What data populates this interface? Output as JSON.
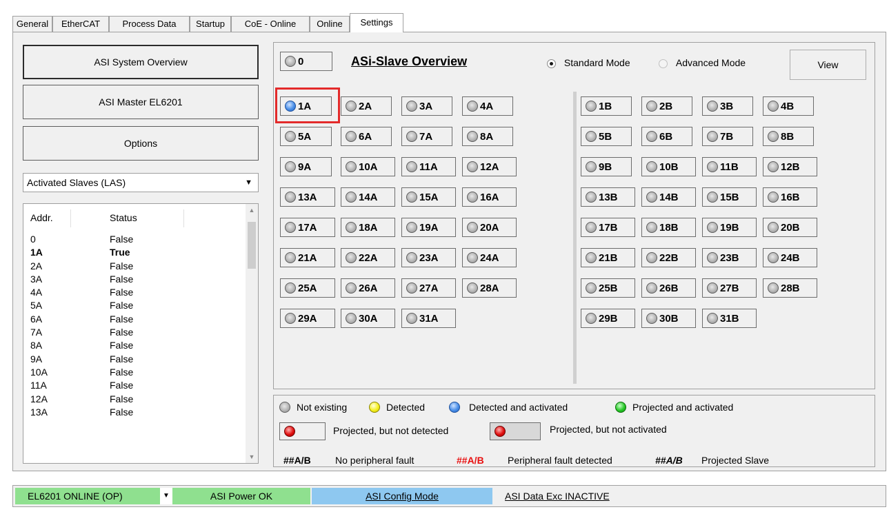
{
  "tabs": [
    "General",
    "EtherCAT",
    "Process Data",
    "Startup",
    "CoE - Online",
    "Online",
    "Settings"
  ],
  "left": {
    "btn_overview": "ASI System Overview",
    "btn_master": "ASI Master EL6201",
    "btn_options": "Options",
    "dropdown": "Activated Slaves (LAS)",
    "col_addr": "Addr.",
    "col_status": "Status",
    "rows": [
      [
        "0",
        "False"
      ],
      [
        "1A",
        "True"
      ],
      [
        "2A",
        "False"
      ],
      [
        "3A",
        "False"
      ],
      [
        "4A",
        "False"
      ],
      [
        "5A",
        "False"
      ],
      [
        "6A",
        "False"
      ],
      [
        "7A",
        "False"
      ],
      [
        "8A",
        "False"
      ],
      [
        "9A",
        "False"
      ],
      [
        "10A",
        "False"
      ],
      [
        "11A",
        "False"
      ],
      [
        "12A",
        "False"
      ],
      [
        "13A",
        "False"
      ]
    ]
  },
  "main": {
    "slave0": "0",
    "title": "ASi-Slave Overview",
    "standard_mode": "Standard Mode",
    "advanced_mode": "Advanced Mode",
    "view": "View",
    "a_slaves": [
      "1A",
      "2A",
      "3A",
      "4A",
      "5A",
      "6A",
      "7A",
      "8A",
      "9A",
      "10A",
      "11A",
      "12A",
      "13A",
      "14A",
      "15A",
      "16A",
      "17A",
      "18A",
      "19A",
      "20A",
      "21A",
      "22A",
      "23A",
      "24A",
      "25A",
      "26A",
      "27A",
      "28A",
      "29A",
      "30A",
      "31A"
    ],
    "b_slaves": [
      "1B",
      "2B",
      "3B",
      "4B",
      "5B",
      "6B",
      "7B",
      "8B",
      "9B",
      "10B",
      "11B",
      "12B",
      "13B",
      "14B",
      "15B",
      "16B",
      "17B",
      "18B",
      "19B",
      "20B",
      "21B",
      "22B",
      "23B",
      "24B",
      "25B",
      "26B",
      "27B",
      "28B",
      "29B",
      "30B",
      "31B"
    ]
  },
  "legend": {
    "not_existing": "Not existing",
    "detected": "Detected",
    "detected_activated": "Detected and activated",
    "projected_activated": "Projected and activated",
    "projected_not_detected": "Projected, but not detected",
    "projected_not_activated": "Projected, but not activated",
    "code": "##A/B",
    "no_fault": "No peripheral fault",
    "fault": "Peripheral fault detected",
    "projected_slave": "Projected Slave"
  },
  "statusbar": {
    "online": "EL6201 ONLINE (OP)",
    "power": "ASI Power OK",
    "config": "ASI Config Mode",
    "data": "ASI Data Exc INACTIVE"
  },
  "colors": {
    "online_bg": "#8fe08f",
    "power_bg": "#8fe08f",
    "config_bg": "#8ec8f0",
    "highlight": "#e32a2a",
    "fault_text": "#e81010"
  }
}
